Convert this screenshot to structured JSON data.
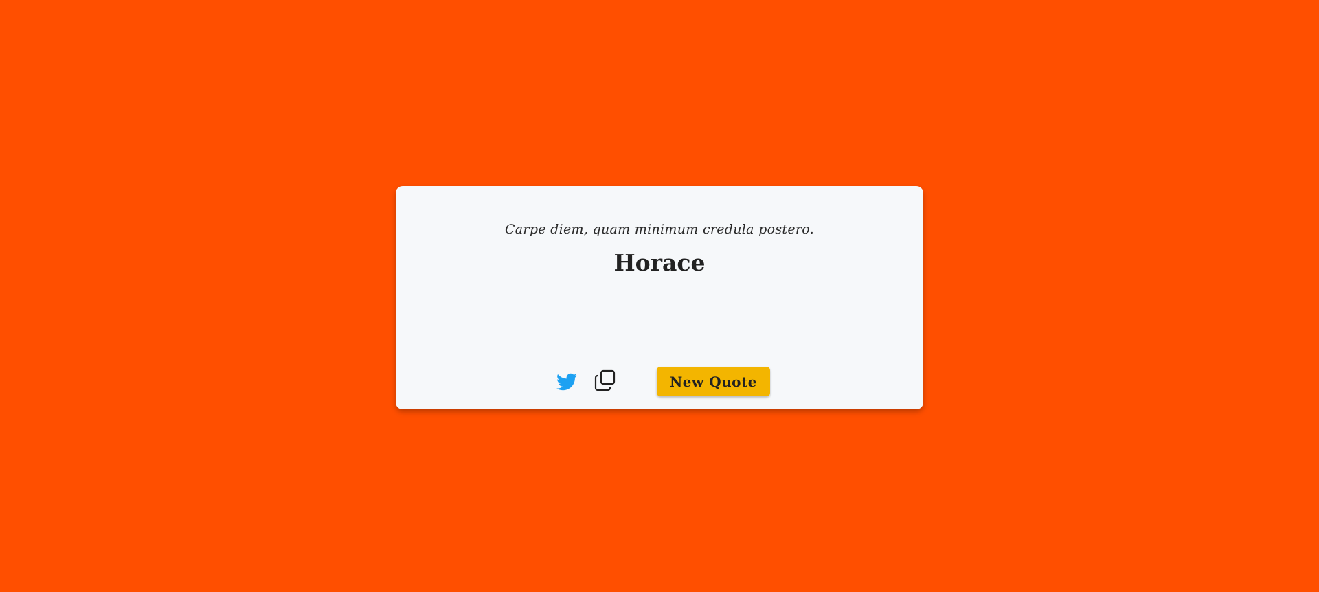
{
  "quote": {
    "text": "Carpe diem, quam minimum credula postero.",
    "author": "Horace"
  },
  "actions": {
    "tweet_icon": "twitter-icon",
    "copy_icon": "copy-icon",
    "new_quote_label": "New Quote"
  },
  "colors": {
    "background": "#ff4f00",
    "card": "#f6f8fa",
    "button": "#f3b500",
    "twitter": "#1da1f2"
  }
}
